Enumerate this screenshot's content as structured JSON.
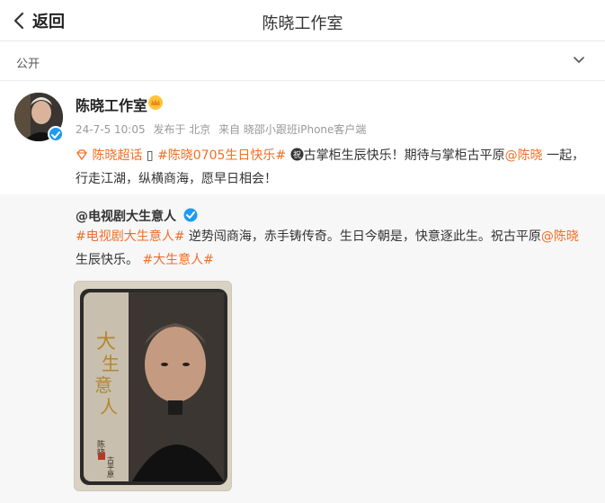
{
  "header": {
    "back_label": "返回",
    "title": "陈晓工作室"
  },
  "visibility": {
    "label": "公开"
  },
  "post": {
    "author": "陈晓工作室",
    "time": "24-7-5 10:05",
    "posted_from": "发布于 北京",
    "client": "来自 晓邵小跟班iPhone客户端",
    "topic_chaohua": "陈晓超话",
    "separator_glyph": "▯",
    "topic_birthday": "#陈晓0705生日快乐#",
    "text_part1": "古掌柜生辰快乐！期待与掌柜古平原",
    "mention": "@陈晓",
    "text_part2": " 一起，行走江湖，纵横商海，愿早日相会！"
  },
  "repost": {
    "author": "@电视剧大生意人",
    "topic_drama": "#电视剧大生意人#",
    "text_part1": " 逆势闯商海，赤手铸传奇。生日今朝是，快意逐此生。祝古平原",
    "mention": "@陈晓",
    "text_part2": " 生辰快乐。 ",
    "topic_end": "#大生意人#"
  },
  "poster": {
    "title": "大生意人",
    "actor": "陈晓",
    "role": "古平原"
  },
  "colors": {
    "link_orange": "#f06e25",
    "verify_blue": "#1e9bf0",
    "repost_bg": "#f7f7f7"
  },
  "icons": {
    "back": "chevron-left-icon",
    "visibility": "chevron-down-icon",
    "crown": "crown-icon",
    "verify": "verified-badge-icon",
    "chaohua": "diamond-icon",
    "wish": "wish-icon"
  }
}
